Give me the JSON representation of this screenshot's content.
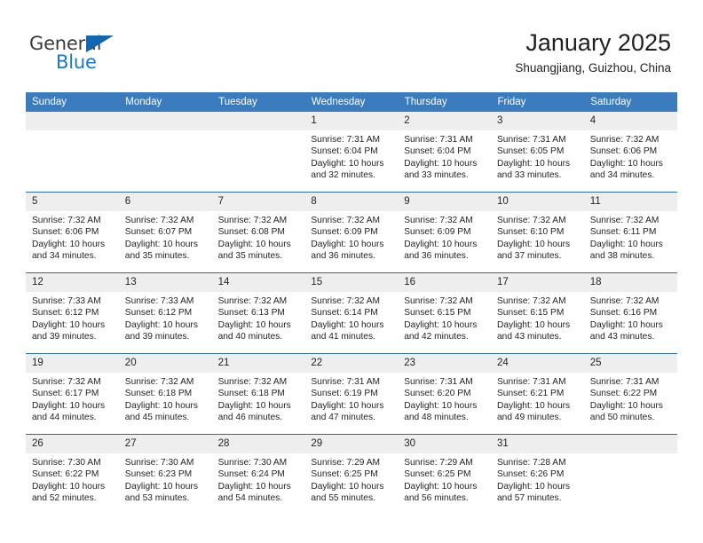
{
  "brand": {
    "name_part1": "General",
    "name_part2": "Blue",
    "triangle_color": "#1166b0"
  },
  "header": {
    "title": "January 2025",
    "subtitle": "Shuangjiang, Guizhou, China"
  },
  "theme": {
    "header_blue": "#3a7cbe",
    "row_divider_blue": "#2e6ca4",
    "daynum_band": "#eeeeee"
  },
  "weekday_headers": [
    "Sunday",
    "Monday",
    "Tuesday",
    "Wednesday",
    "Thursday",
    "Friday",
    "Saturday"
  ],
  "labels": {
    "sunrise_prefix": "Sunrise:",
    "sunset_prefix": "Sunset:",
    "daylight_prefix": "Daylight:"
  },
  "weeks": [
    [
      {
        "empty": true
      },
      {
        "empty": true
      },
      {
        "empty": true
      },
      {
        "day": "1",
        "line1": "Sunrise: 7:31 AM",
        "line2": "Sunset: 6:04 PM",
        "line3": "Daylight: 10 hours",
        "line4": "and 32 minutes."
      },
      {
        "day": "2",
        "line1": "Sunrise: 7:31 AM",
        "line2": "Sunset: 6:04 PM",
        "line3": "Daylight: 10 hours",
        "line4": "and 33 minutes."
      },
      {
        "day": "3",
        "line1": "Sunrise: 7:31 AM",
        "line2": "Sunset: 6:05 PM",
        "line3": "Daylight: 10 hours",
        "line4": "and 33 minutes."
      },
      {
        "day": "4",
        "line1": "Sunrise: 7:32 AM",
        "line2": "Sunset: 6:06 PM",
        "line3": "Daylight: 10 hours",
        "line4": "and 34 minutes."
      }
    ],
    [
      {
        "day": "5",
        "line1": "Sunrise: 7:32 AM",
        "line2": "Sunset: 6:06 PM",
        "line3": "Daylight: 10 hours",
        "line4": "and 34 minutes."
      },
      {
        "day": "6",
        "line1": "Sunrise: 7:32 AM",
        "line2": "Sunset: 6:07 PM",
        "line3": "Daylight: 10 hours",
        "line4": "and 35 minutes."
      },
      {
        "day": "7",
        "line1": "Sunrise: 7:32 AM",
        "line2": "Sunset: 6:08 PM",
        "line3": "Daylight: 10 hours",
        "line4": "and 35 minutes."
      },
      {
        "day": "8",
        "line1": "Sunrise: 7:32 AM",
        "line2": "Sunset: 6:09 PM",
        "line3": "Daylight: 10 hours",
        "line4": "and 36 minutes."
      },
      {
        "day": "9",
        "line1": "Sunrise: 7:32 AM",
        "line2": "Sunset: 6:09 PM",
        "line3": "Daylight: 10 hours",
        "line4": "and 36 minutes."
      },
      {
        "day": "10",
        "line1": "Sunrise: 7:32 AM",
        "line2": "Sunset: 6:10 PM",
        "line3": "Daylight: 10 hours",
        "line4": "and 37 minutes."
      },
      {
        "day": "11",
        "line1": "Sunrise: 7:32 AM",
        "line2": "Sunset: 6:11 PM",
        "line3": "Daylight: 10 hours",
        "line4": "and 38 minutes."
      }
    ],
    [
      {
        "day": "12",
        "line1": "Sunrise: 7:33 AM",
        "line2": "Sunset: 6:12 PM",
        "line3": "Daylight: 10 hours",
        "line4": "and 39 minutes."
      },
      {
        "day": "13",
        "line1": "Sunrise: 7:33 AM",
        "line2": "Sunset: 6:12 PM",
        "line3": "Daylight: 10 hours",
        "line4": "and 39 minutes."
      },
      {
        "day": "14",
        "line1": "Sunrise: 7:32 AM",
        "line2": "Sunset: 6:13 PM",
        "line3": "Daylight: 10 hours",
        "line4": "and 40 minutes."
      },
      {
        "day": "15",
        "line1": "Sunrise: 7:32 AM",
        "line2": "Sunset: 6:14 PM",
        "line3": "Daylight: 10 hours",
        "line4": "and 41 minutes."
      },
      {
        "day": "16",
        "line1": "Sunrise: 7:32 AM",
        "line2": "Sunset: 6:15 PM",
        "line3": "Daylight: 10 hours",
        "line4": "and 42 minutes."
      },
      {
        "day": "17",
        "line1": "Sunrise: 7:32 AM",
        "line2": "Sunset: 6:15 PM",
        "line3": "Daylight: 10 hours",
        "line4": "and 43 minutes."
      },
      {
        "day": "18",
        "line1": "Sunrise: 7:32 AM",
        "line2": "Sunset: 6:16 PM",
        "line3": "Daylight: 10 hours",
        "line4": "and 43 minutes."
      }
    ],
    [
      {
        "day": "19",
        "line1": "Sunrise: 7:32 AM",
        "line2": "Sunset: 6:17 PM",
        "line3": "Daylight: 10 hours",
        "line4": "and 44 minutes."
      },
      {
        "day": "20",
        "line1": "Sunrise: 7:32 AM",
        "line2": "Sunset: 6:18 PM",
        "line3": "Daylight: 10 hours",
        "line4": "and 45 minutes."
      },
      {
        "day": "21",
        "line1": "Sunrise: 7:32 AM",
        "line2": "Sunset: 6:18 PM",
        "line3": "Daylight: 10 hours",
        "line4": "and 46 minutes."
      },
      {
        "day": "22",
        "line1": "Sunrise: 7:31 AM",
        "line2": "Sunset: 6:19 PM",
        "line3": "Daylight: 10 hours",
        "line4": "and 47 minutes."
      },
      {
        "day": "23",
        "line1": "Sunrise: 7:31 AM",
        "line2": "Sunset: 6:20 PM",
        "line3": "Daylight: 10 hours",
        "line4": "and 48 minutes."
      },
      {
        "day": "24",
        "line1": "Sunrise: 7:31 AM",
        "line2": "Sunset: 6:21 PM",
        "line3": "Daylight: 10 hours",
        "line4": "and 49 minutes."
      },
      {
        "day": "25",
        "line1": "Sunrise: 7:31 AM",
        "line2": "Sunset: 6:22 PM",
        "line3": "Daylight: 10 hours",
        "line4": "and 50 minutes."
      }
    ],
    [
      {
        "day": "26",
        "line1": "Sunrise: 7:30 AM",
        "line2": "Sunset: 6:22 PM",
        "line3": "Daylight: 10 hours",
        "line4": "and 52 minutes."
      },
      {
        "day": "27",
        "line1": "Sunrise: 7:30 AM",
        "line2": "Sunset: 6:23 PM",
        "line3": "Daylight: 10 hours",
        "line4": "and 53 minutes."
      },
      {
        "day": "28",
        "line1": "Sunrise: 7:30 AM",
        "line2": "Sunset: 6:24 PM",
        "line3": "Daylight: 10 hours",
        "line4": "and 54 minutes."
      },
      {
        "day": "29",
        "line1": "Sunrise: 7:29 AM",
        "line2": "Sunset: 6:25 PM",
        "line3": "Daylight: 10 hours",
        "line4": "and 55 minutes."
      },
      {
        "day": "30",
        "line1": "Sunrise: 7:29 AM",
        "line2": "Sunset: 6:25 PM",
        "line3": "Daylight: 10 hours",
        "line4": "and 56 minutes."
      },
      {
        "day": "31",
        "line1": "Sunrise: 7:28 AM",
        "line2": "Sunset: 6:26 PM",
        "line3": "Daylight: 10 hours",
        "line4": "and 57 minutes."
      },
      {
        "empty": true
      }
    ]
  ]
}
